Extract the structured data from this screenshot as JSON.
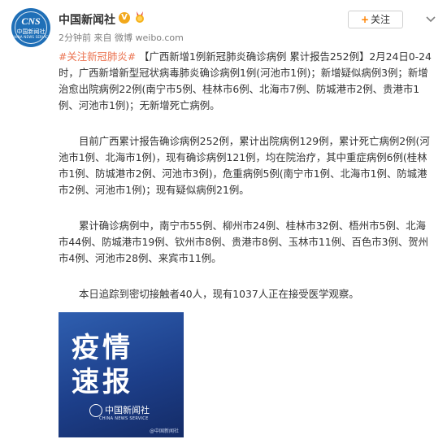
{
  "header": {
    "avatar": {
      "abbr": "CNS",
      "cn_name": "中国新闻社",
      "en_name": "CHINA NEWS SERVICE"
    },
    "account_name": "中国新闻社",
    "verified_badge": "V",
    "meta_time": "2分钟前",
    "meta_source": "来自 微博 weibo.com",
    "follow_label": "关注",
    "accent_color": "#ff8200",
    "link_color": "#eb7350"
  },
  "post": {
    "topic_tag": "#关注新冠肺炎#",
    "headline": "【广西新增1例新冠肺炎确诊病例 累计报告252例】",
    "p1_rest": "2月24日0-24时，广西新增新型冠状病毒肺炎确诊病例1例(河池市1例)；新增疑似病例3例；新增治愈出院病例22例(南宁市5例、桂林市6例、北海市7例、防城港市2例、贵港市1例、河池市1例)；无新增死亡病例。",
    "p2": "目前广西累计报告确诊病例252例，累计出院病例129例，累计死亡病例2例(河池市1例、北海市1例)，现有确诊病例121例，均在院治疗，其中重症病例6例(桂林市1例、防城港市2例、河池市3例)，危重病例5例(南宁市1例、北海市1例、防城港市2例、河池市1例)；现有疑似病例21例。",
    "p3": "累计确诊病例中，南宁市55例、柳州市24例、桂林市32例、梧州市5例、北海市44例、防城港市19例、钦州市8例、贵港市8例、玉林市11例、百色市3例、贺州市4例、河池市28例、来宾市11例。",
    "p4": "本日追踪到密切接触者40人，现有1037人正在接受医学观察。"
  },
  "poster": {
    "line1": "疫情",
    "line2": "速报",
    "logo_cn": "中国新闻社",
    "logo_en": "CHINA NEWS SERVICE",
    "watermark": "@中国新闻社"
  }
}
